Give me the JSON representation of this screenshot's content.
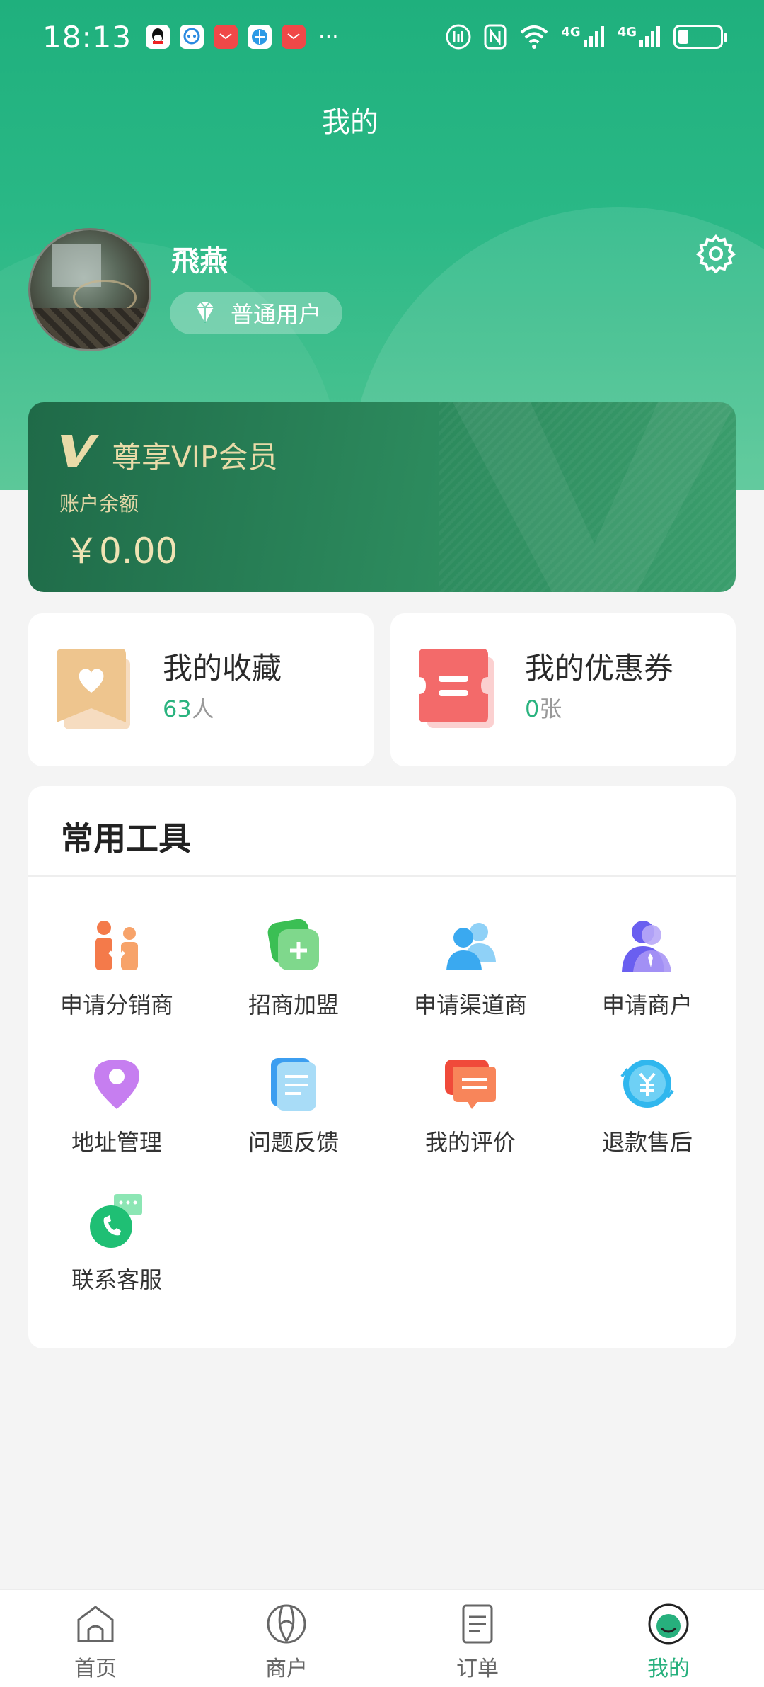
{
  "status_bar": {
    "time": "18:13",
    "more": "···",
    "network_1": "4G",
    "network_2": "4G"
  },
  "header": {
    "title": "我的"
  },
  "user": {
    "name": "飛燕",
    "badge": "普通用户"
  },
  "vip": {
    "title": "尊享VIP会员",
    "balance_label": "账户余额",
    "balance_value": "￥0.00"
  },
  "stats": {
    "favorites": {
      "title": "我的收藏",
      "count": "63",
      "unit": "人"
    },
    "coupons": {
      "title": "我的优惠券",
      "count": "0",
      "unit": "张"
    }
  },
  "tools": {
    "title": "常用工具",
    "items": [
      {
        "label": "申请分销商",
        "icon": "distributor-icon"
      },
      {
        "label": "招商加盟",
        "icon": "franchise-icon"
      },
      {
        "label": "申请渠道商",
        "icon": "channel-partner-icon"
      },
      {
        "label": "申请商户",
        "icon": "merchant-apply-icon"
      },
      {
        "label": "地址管理",
        "icon": "location-pin-icon"
      },
      {
        "label": "问题反馈",
        "icon": "feedback-document-icon"
      },
      {
        "label": "我的评价",
        "icon": "review-chat-icon"
      },
      {
        "label": "退款售后",
        "icon": "refund-yen-icon"
      },
      {
        "label": "联系客服",
        "icon": "customer-service-phone-icon"
      }
    ]
  },
  "tabs": [
    {
      "label": "首页",
      "icon": "home-icon"
    },
    {
      "label": "商户",
      "icon": "merchant-icon"
    },
    {
      "label": "订单",
      "icon": "order-icon"
    },
    {
      "label": "我的",
      "icon": "profile-icon",
      "active": true
    }
  ],
  "colors": {
    "brand_green": "#1fb07d",
    "active_tab": "#27b07d",
    "vip_gold": "#e9dba8"
  }
}
